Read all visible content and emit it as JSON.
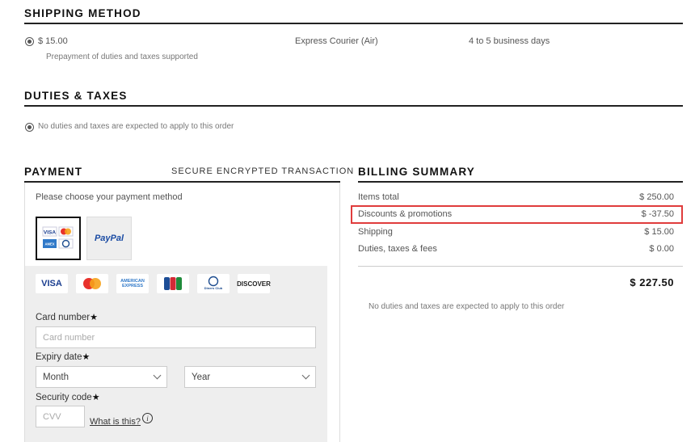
{
  "shipping": {
    "title": "SHIPPING METHOD",
    "option": {
      "price": "$ 15.00",
      "note": "Prepayment of duties and taxes supported",
      "carrier": "Express Courier (Air)",
      "eta": "4 to 5 business days"
    }
  },
  "duties": {
    "title": "DUTIES & TAXES",
    "option_label": "No duties and taxes are expected to apply to this order"
  },
  "payment": {
    "title": "PAYMENT",
    "secure_label": "SECURE ENCRYPTED TRANSACTION",
    "choose_label": "Please choose your payment method",
    "methods": [
      "Cards",
      "PayPal"
    ],
    "paypal_label": "PayPal",
    "card_logos": [
      "VISA",
      "Mastercard",
      "AMERICAN EXPRESS",
      "JCB",
      "Diners Club",
      "DISCOVER"
    ],
    "card_number": {
      "label": "Card number",
      "placeholder": "Card number"
    },
    "expiry": {
      "label": "Expiry date",
      "month": "Month",
      "year": "Year"
    },
    "security": {
      "label": "Security code",
      "placeholder": "CVV",
      "help_link": "What is this?"
    },
    "required_mark": "★"
  },
  "billing": {
    "title": "BILLING SUMMARY",
    "rows": [
      {
        "label": "Items total",
        "value": "$ 250.00"
      },
      {
        "label": "Discounts & promotions",
        "value": "$ -37.50"
      },
      {
        "label": "Shipping",
        "value": "$ 15.00"
      },
      {
        "label": "Duties, taxes & fees",
        "value": "$ 0.00"
      }
    ],
    "total": "$ 227.50",
    "note": "No duties and taxes are expected to apply to this order",
    "highlight_color": "#e03c3c"
  }
}
